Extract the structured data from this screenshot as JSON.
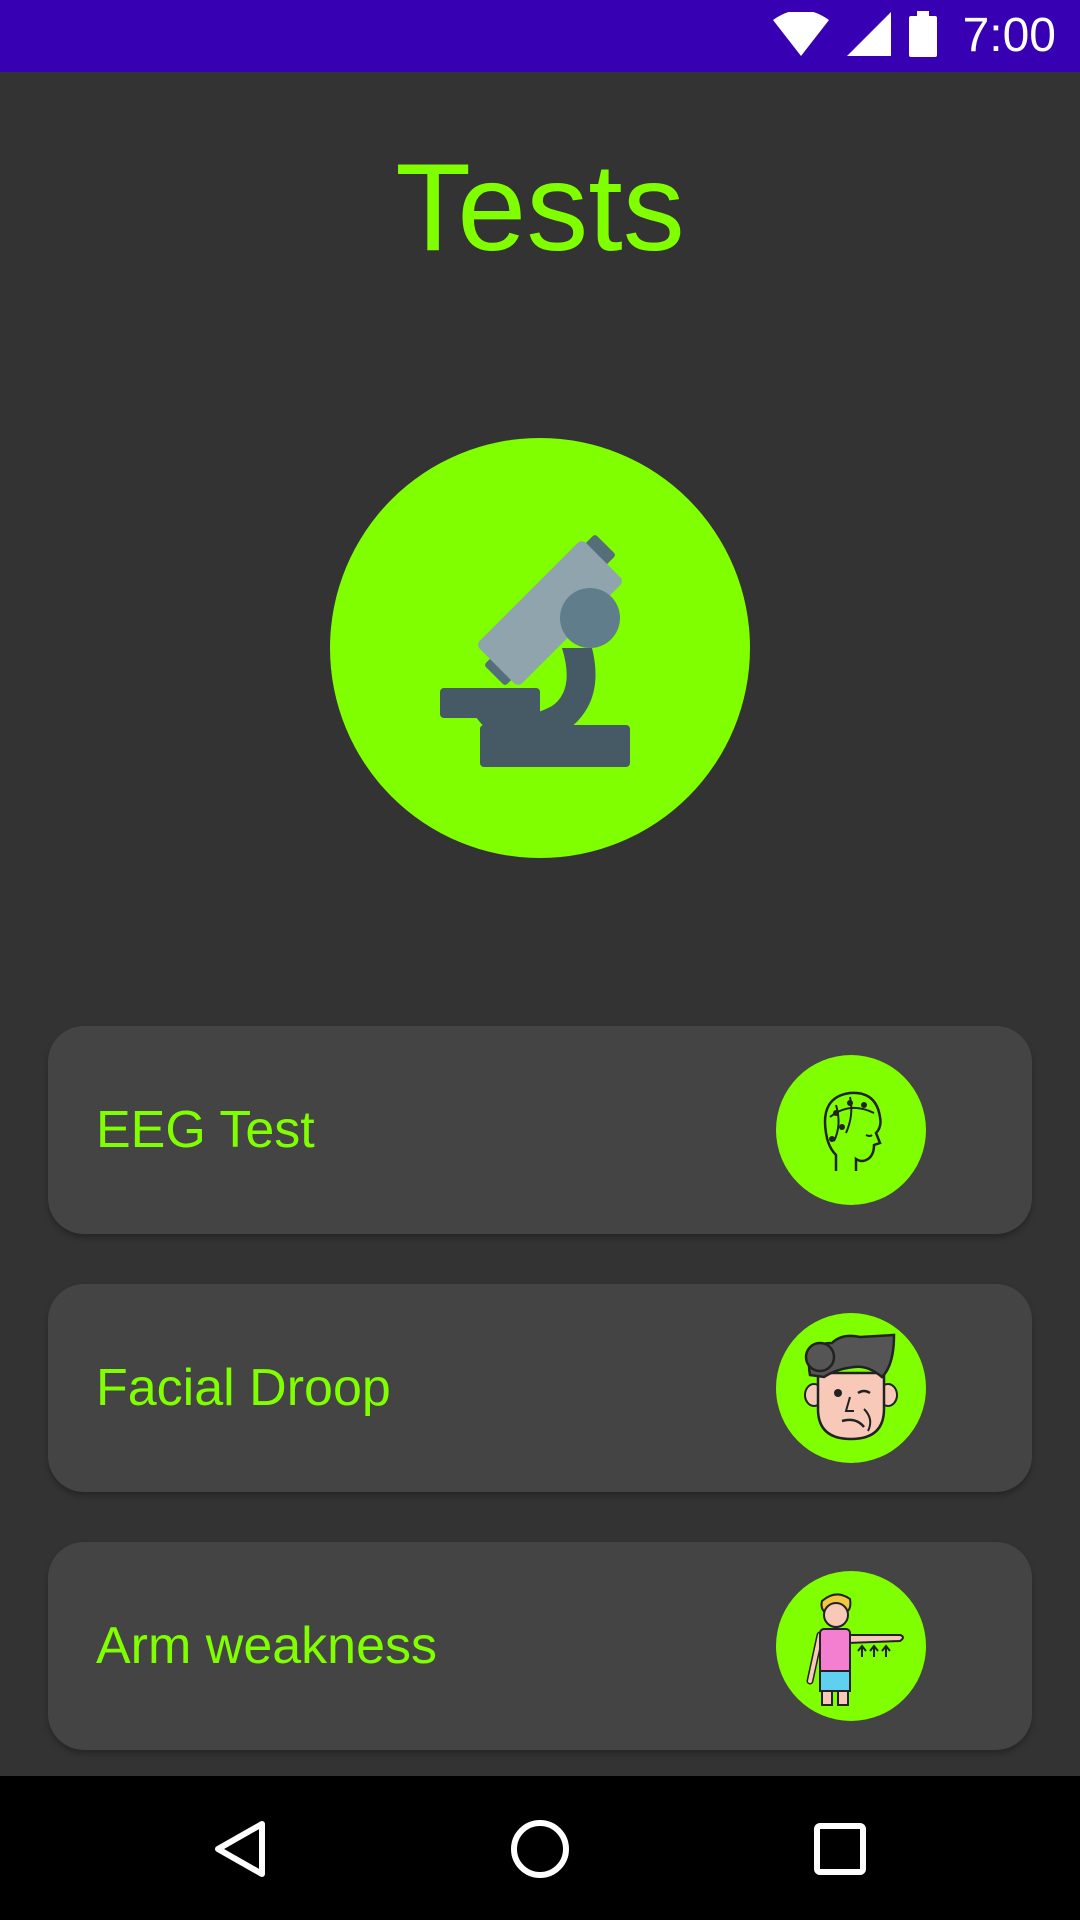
{
  "status_bar": {
    "time": "7:00",
    "icons": [
      "wifi-icon",
      "cell-signal-icon",
      "battery-icon"
    ],
    "background": "#3700b3"
  },
  "header": {
    "title": "Tests"
  },
  "hero": {
    "icon": "microscope-icon",
    "background": "#7fff00"
  },
  "tests": [
    {
      "label": "EEG Test",
      "icon": "eeg-head-icon"
    },
    {
      "label": "Facial Droop",
      "icon": "facial-droop-face-icon"
    },
    {
      "label": "Arm weakness",
      "icon": "arm-weakness-person-icon"
    }
  ],
  "nav_bar": {
    "buttons": [
      "back-icon",
      "home-icon",
      "recents-icon"
    ]
  },
  "colors": {
    "accent": "#7fff00",
    "background": "#333333",
    "card": "#444444"
  }
}
